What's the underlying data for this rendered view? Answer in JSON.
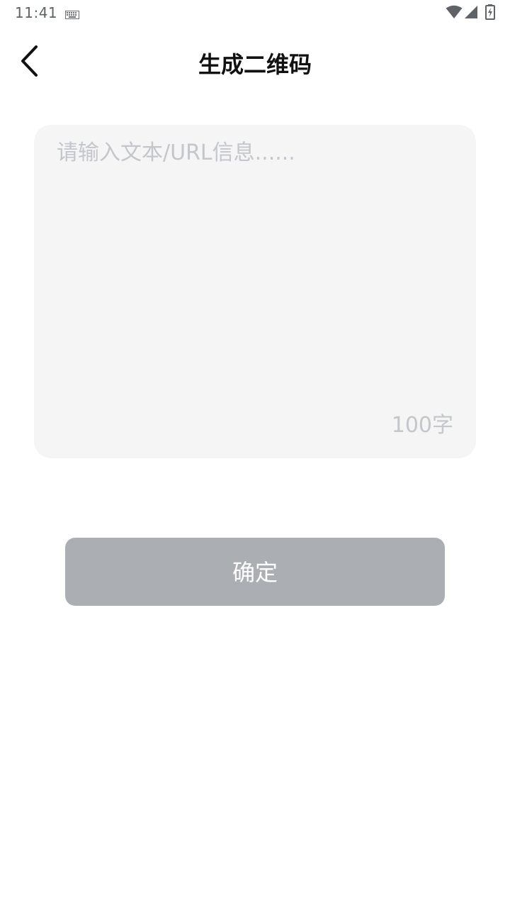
{
  "status_bar": {
    "time": "11:41",
    "icons": [
      "keyboard-icon",
      "wifi-icon",
      "cell-signal-icon",
      "battery-charging-icon"
    ]
  },
  "header": {
    "title": "生成二维码",
    "back_icon": "chevron-left-icon"
  },
  "input": {
    "placeholder": "请输入文本/URL信息......",
    "value": "",
    "char_limit_label": "100字"
  },
  "confirm": {
    "label": "确定"
  },
  "colors": {
    "input_background": "#f5f5f5",
    "placeholder": "#c4c6cc",
    "button_disabled": "#abafb3",
    "title": "#111111"
  }
}
